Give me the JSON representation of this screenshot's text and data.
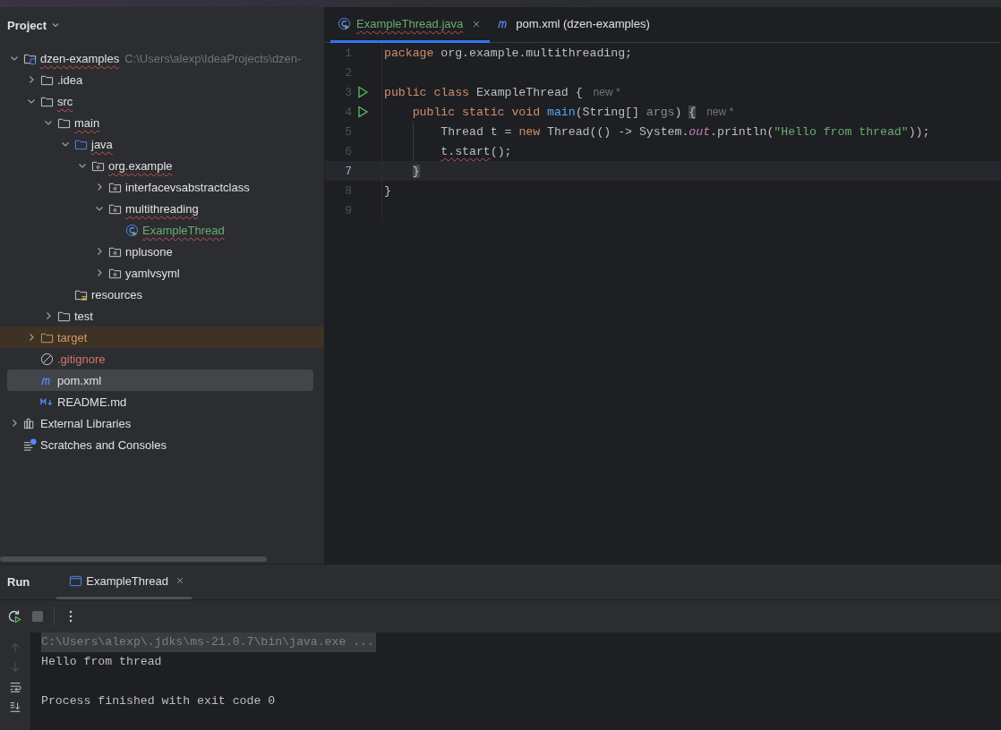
{
  "project_panel": {
    "title": "Project",
    "tree": [
      {
        "label": "dzen-examples",
        "note": "C:\\Users\\alexp\\IdeaProjects\\dzen-",
        "kind": "module",
        "expanded": true,
        "selected": false,
        "typo": true,
        "color": "#dfe1e5",
        "children": [
          {
            "label": ".idea",
            "kind": "folder",
            "expanded": false,
            "selected": false,
            "typo": false,
            "color": "#dfe1e5"
          },
          {
            "label": "src",
            "kind": "folder",
            "expanded": true,
            "selected": false,
            "typo": true,
            "color": "#dfe1e5",
            "children": [
              {
                "label": "main",
                "kind": "folder",
                "expanded": true,
                "selected": false,
                "typo": true,
                "color": "#dfe1e5",
                "children": [
                  {
                    "label": "java",
                    "kind": "source-folder",
                    "expanded": true,
                    "selected": false,
                    "typo": true,
                    "color": "#dfe1e5",
                    "children": [
                      {
                        "label": "org.example",
                        "kind": "package",
                        "expanded": true,
                        "selected": false,
                        "typo": true,
                        "color": "#dfe1e5",
                        "children": [
                          {
                            "label": "interfacevsabstractclass",
                            "kind": "package",
                            "expanded": false,
                            "selected": false,
                            "typo": false,
                            "color": "#dfe1e5"
                          },
                          {
                            "label": "multithreading",
                            "kind": "package",
                            "expanded": true,
                            "selected": false,
                            "typo": true,
                            "color": "#dfe1e5",
                            "children": [
                              {
                                "label": "ExampleThread",
                                "kind": "java-class",
                                "selected": false,
                                "typo": true,
                                "color": "#6aab73"
                              }
                            ]
                          },
                          {
                            "label": "nplusone",
                            "kind": "package",
                            "expanded": false,
                            "selected": false,
                            "typo": false,
                            "color": "#dfe1e5"
                          },
                          {
                            "label": "yamlvsyml",
                            "kind": "package",
                            "expanded": false,
                            "selected": false,
                            "typo": false,
                            "color": "#dfe1e5"
                          }
                        ]
                      }
                    ]
                  },
                  {
                    "label": "resources",
                    "kind": "resources",
                    "selected": false,
                    "typo": false,
                    "color": "#dfe1e5"
                  }
                ]
              },
              {
                "label": "test",
                "kind": "folder",
                "expanded": false,
                "selected": false,
                "typo": false,
                "color": "#dfe1e5"
              }
            ]
          },
          {
            "label": "target",
            "kind": "excluded-folder",
            "expanded": false,
            "selected": false,
            "typo": false,
            "color": "#d19a66"
          },
          {
            "label": ".gitignore",
            "kind": "ignored-file",
            "selected": false,
            "typo": false,
            "color": "#d5756c"
          },
          {
            "label": "pom.xml",
            "kind": "maven",
            "selected": true,
            "typo": false,
            "color": "#dfe1e5"
          },
          {
            "label": "README.md",
            "kind": "markdown",
            "selected": false,
            "typo": false,
            "color": "#dfe1e5"
          }
        ]
      },
      {
        "label": "External Libraries",
        "kind": "libraries",
        "expanded": false,
        "selected": false,
        "typo": false,
        "color": "#dfe1e5"
      },
      {
        "label": "Scratches and Consoles",
        "kind": "scratches",
        "selected": false,
        "typo": false,
        "color": "#dfe1e5"
      }
    ]
  },
  "editor": {
    "tabs": [
      {
        "label": "ExampleThread.java",
        "kind": "java-class",
        "selected": true,
        "typo": true,
        "closable": true,
        "color": "#6aab73"
      },
      {
        "label": "pom.xml (dzen-examples)",
        "kind": "maven",
        "selected": false,
        "typo": false,
        "closable": false,
        "color": "#dfe1e5"
      }
    ],
    "lines": [
      {
        "number": "1",
        "run_marker": false,
        "current": false,
        "indent_guide": false,
        "tokens": [
          {
            "kind": "keyword",
            "text": "package"
          },
          {
            "kind": "plain",
            "text": " org.example.multithreading;"
          }
        ]
      },
      {
        "number": "2",
        "run_marker": false,
        "current": false,
        "indent_guide": false
      },
      {
        "number": "3",
        "run_marker": true,
        "current": false,
        "indent_guide": false,
        "tokens": [
          {
            "kind": "keyword",
            "text": "public class"
          },
          {
            "kind": "plain",
            "text": " ExampleThread {"
          },
          {
            "kind": "hint",
            "text": "new *"
          }
        ]
      },
      {
        "number": "4",
        "run_marker": true,
        "current": false,
        "indent_guide": false,
        "tokens": [
          {
            "kind": "keyword",
            "text": "    public static void"
          },
          {
            "kind": "method",
            "text": " main"
          },
          {
            "kind": "plain",
            "text": "(String[] "
          },
          {
            "kind": "param",
            "text": "args"
          },
          {
            "kind": "plain",
            "text": ") "
          },
          {
            "kind": "match",
            "text": "{"
          },
          {
            "kind": "hint",
            "text": "new *"
          }
        ]
      },
      {
        "number": "5",
        "run_marker": false,
        "current": false,
        "indent_guide": true,
        "tokens": [
          {
            "kind": "plain",
            "text": "        Thread t = "
          },
          {
            "kind": "keyword",
            "text": "new"
          },
          {
            "kind": "plain",
            "text": " Thread(() -> System."
          },
          {
            "kind": "field",
            "text": "out"
          },
          {
            "kind": "plain",
            "text": ".println("
          },
          {
            "kind": "string",
            "text": "\"Hello from thread\""
          },
          {
            "kind": "plain",
            "text": "));"
          }
        ]
      },
      {
        "number": "6",
        "run_marker": false,
        "current": false,
        "indent_guide": true,
        "tokens": [
          {
            "kind": "typo",
            "text": "        t.start"
          },
          {
            "kind": "plain",
            "text": "();"
          }
        ]
      },
      {
        "number": "7",
        "run_marker": false,
        "current": true,
        "indent_guide": false,
        "tokens": [
          {
            "kind": "match",
            "text": "    }"
          }
        ]
      },
      {
        "number": "8",
        "run_marker": false,
        "current": false,
        "indent_guide": false,
        "tokens": [
          {
            "kind": "plain",
            "text": "}"
          }
        ]
      },
      {
        "number": "9",
        "run_marker": false,
        "current": false,
        "indent_guide": false
      }
    ]
  },
  "run_panel": {
    "title": "Run",
    "tabs": [
      {
        "label": "ExampleThread",
        "selected": true
      }
    ],
    "console": [
      {
        "kind": "command",
        "text": "C:\\Users\\alexp\\.jdks\\ms-21.0.7\\bin\\java.exe ..."
      },
      {
        "kind": "output",
        "text": "Hello from thread"
      },
      {
        "kind": "exit",
        "text": "Process finished with exit code 0"
      }
    ]
  }
}
